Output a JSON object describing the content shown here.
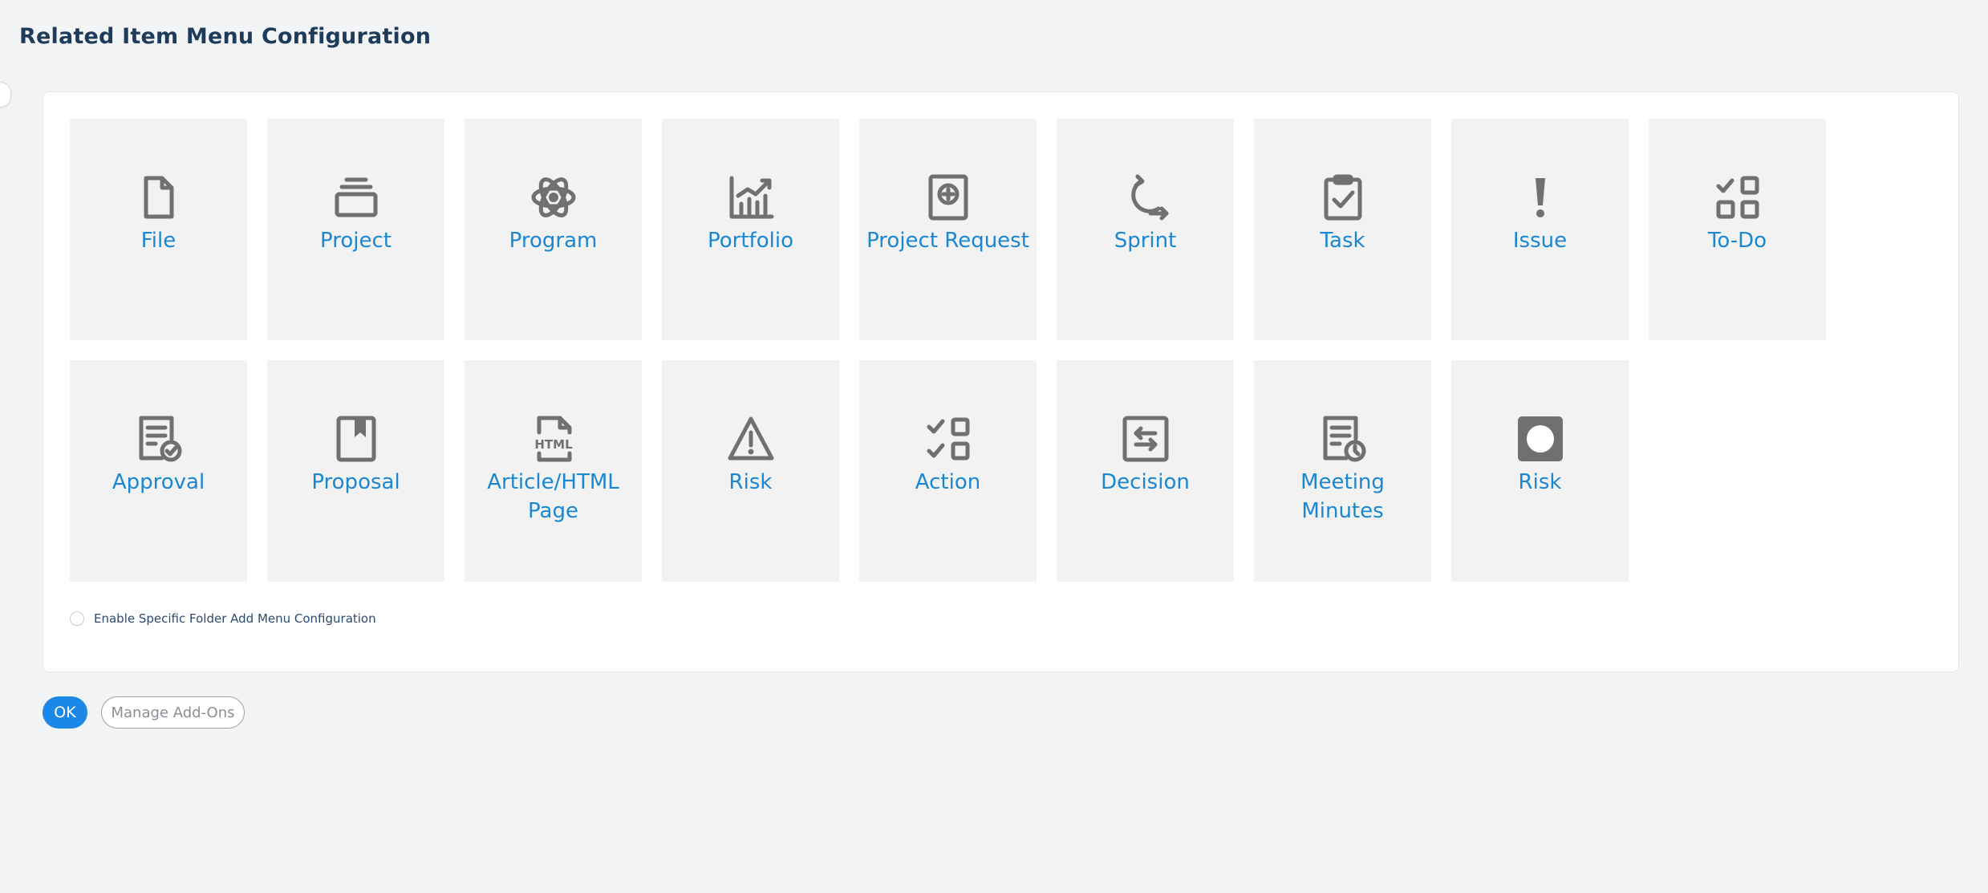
{
  "page": {
    "title": "Related Item Menu Configuration"
  },
  "tiles": [
    {
      "label": "File",
      "icon": "file-icon"
    },
    {
      "label": "Project",
      "icon": "project-stack-icon"
    },
    {
      "label": "Program",
      "icon": "atom-icon"
    },
    {
      "label": "Portfolio",
      "icon": "chart-trend-icon"
    },
    {
      "label": "Project Request",
      "icon": "request-plus-icon"
    },
    {
      "label": "Sprint",
      "icon": "sprint-cycle-icon"
    },
    {
      "label": "Task",
      "icon": "clipboard-check-icon"
    },
    {
      "label": "Issue",
      "icon": "exclamation-icon"
    },
    {
      "label": "To-Do",
      "icon": "todo-grid-icon"
    },
    {
      "label": "Approval",
      "icon": "approval-doc-icon"
    },
    {
      "label": "Proposal",
      "icon": "bookmark-book-icon"
    },
    {
      "label": "Article/HTML Page",
      "icon": "html-file-icon"
    },
    {
      "label": "Risk",
      "icon": "warning-triangle-icon"
    },
    {
      "label": "Action",
      "icon": "checklist-icon"
    },
    {
      "label": "Decision",
      "icon": "decision-arrows-icon"
    },
    {
      "label": "Meeting Minutes",
      "icon": "meeting-doc-clock-icon"
    },
    {
      "label": "Risk",
      "icon": "risk-circle-icon"
    }
  ],
  "options": {
    "enable_folder_label": "Enable Specific Folder Add Menu Configuration",
    "enable_folder_checked": false
  },
  "buttons": {
    "ok": "OK",
    "manage_addons": "Manage Add-Ons"
  },
  "colors": {
    "accent": "#1b87e6",
    "tile_label": "#1b87d0",
    "icon": "#707070",
    "tile_bg": "#f2f2f2"
  }
}
